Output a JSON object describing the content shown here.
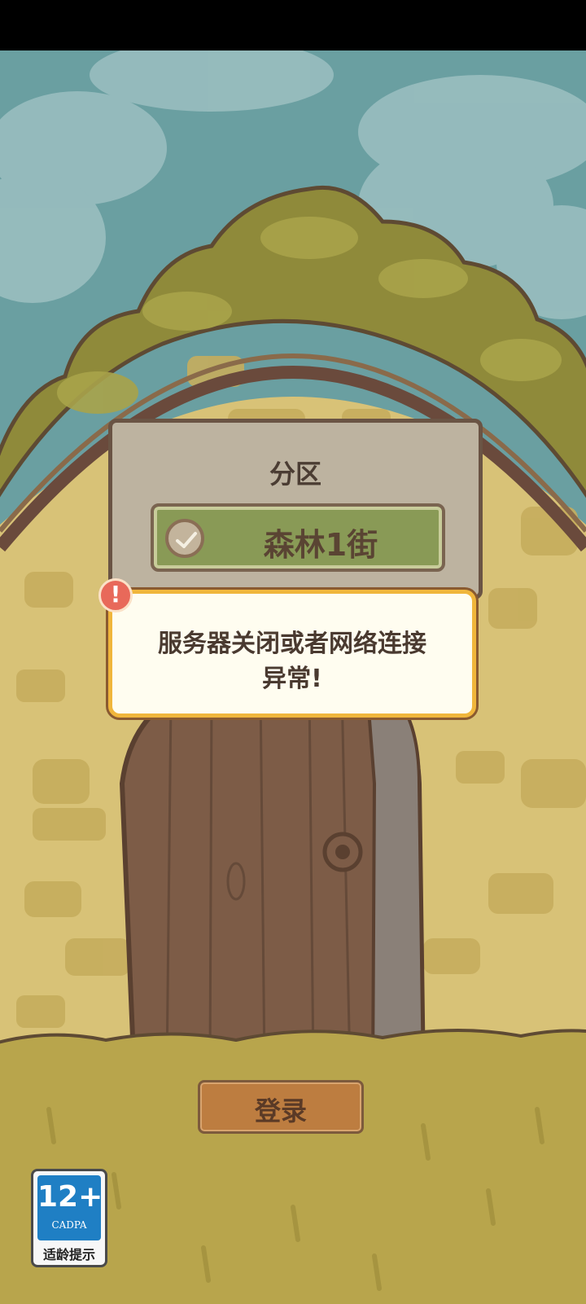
{
  "partition": {
    "title": "分区",
    "server_name": "森林1街"
  },
  "error": {
    "message_line1": "服务器关闭或者网络连接",
    "message_line2": "异常!",
    "alert_glyph": "!"
  },
  "login": {
    "label": "登录"
  },
  "age_rating": {
    "number": "12+",
    "org": "CADPA",
    "caption": "适龄提示"
  },
  "colors": {
    "sky": "#6a9fa1",
    "wall": "#d8c277",
    "grass": "#b8a54c",
    "door": "#7d5c47",
    "panel": "#bdb3a0",
    "server_button": "#899a56",
    "dialog_border": "#f0b63c",
    "login_button": "#bd7d40"
  }
}
